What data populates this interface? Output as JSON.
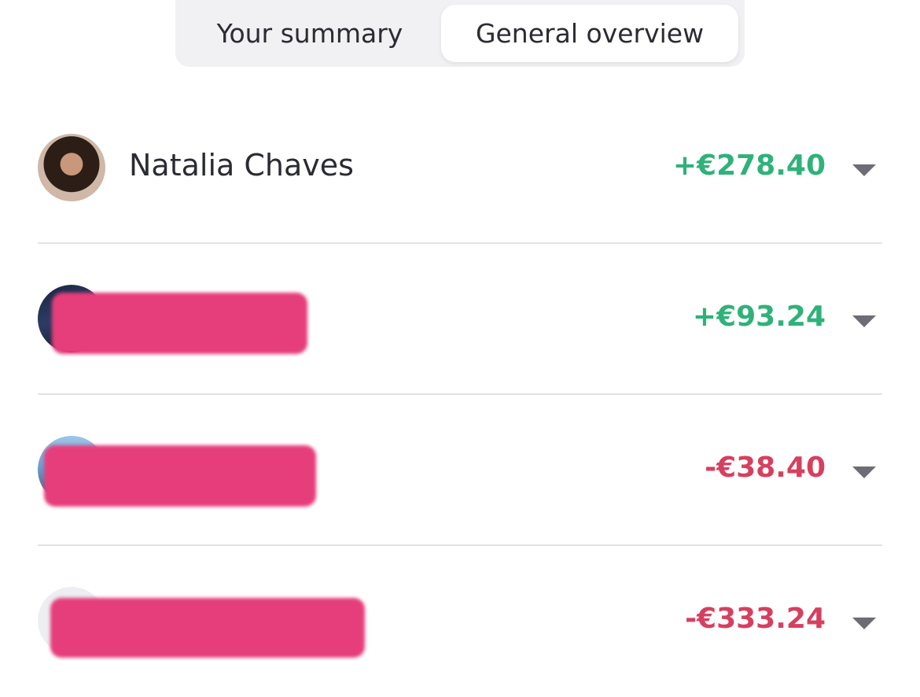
{
  "tabs": {
    "your_summary": "Your summary",
    "general_overview": "General overview",
    "active": "General overview"
  },
  "rows": [
    {
      "name": "Natalia Chaves",
      "amount": "+€278.40",
      "amount_color": "#2fb27a",
      "avatar": "photo"
    },
    {
      "name": "",
      "amount": "+€93.24",
      "amount_color": "#2fb27a",
      "avatar": "photo",
      "redacted": true
    },
    {
      "name": "",
      "amount": "-€38.40",
      "amount_color": "#d6405f",
      "avatar": "photo",
      "redacted": true
    },
    {
      "name": "",
      "amount": "-€333.24",
      "amount_color": "#d6405f",
      "avatar": "placeholder",
      "redacted": true
    }
  ],
  "colors": {
    "positive": "#2fb27a",
    "negative": "#d6405f",
    "redaction": "#e63e7b",
    "chevron": "#6d6d75"
  },
  "icons": [
    "chevron-down-icon"
  ]
}
